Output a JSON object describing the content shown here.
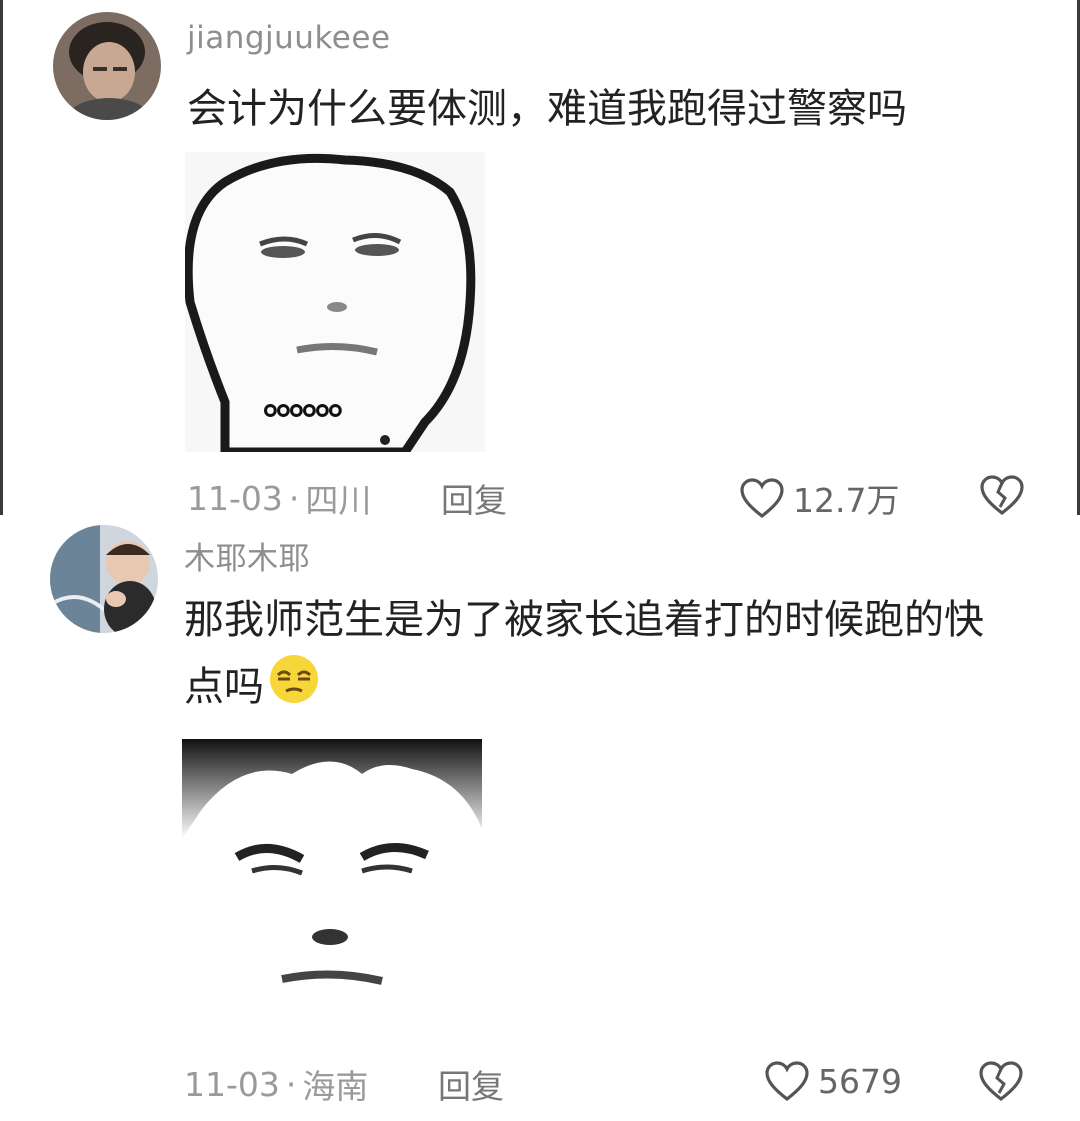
{
  "comments": [
    {
      "username": "jiangjuukeee",
      "text": "会计为什么要体测，难道我跑得过警察吗",
      "meme_caption": "。。。。。。",
      "date": "11-03",
      "separator": "·",
      "location": "四川",
      "reply_label": "回复",
      "likes": "12.7万"
    },
    {
      "username": "木耶木耶",
      "text": "那我师范生是为了被家长追着打的时候跑的快点吗",
      "date": "11-03",
      "separator": "·",
      "location": "海南",
      "reply_label": "回复",
      "likes": "5679"
    }
  ],
  "icons": {
    "like": "heart-outline-icon",
    "dislike": "broken-heart-icon",
    "inline_emoji": "squinting-face-emoji"
  },
  "colors": {
    "text": "#222222",
    "username": "#8e8e8e",
    "meta": "#9a9a9a"
  }
}
